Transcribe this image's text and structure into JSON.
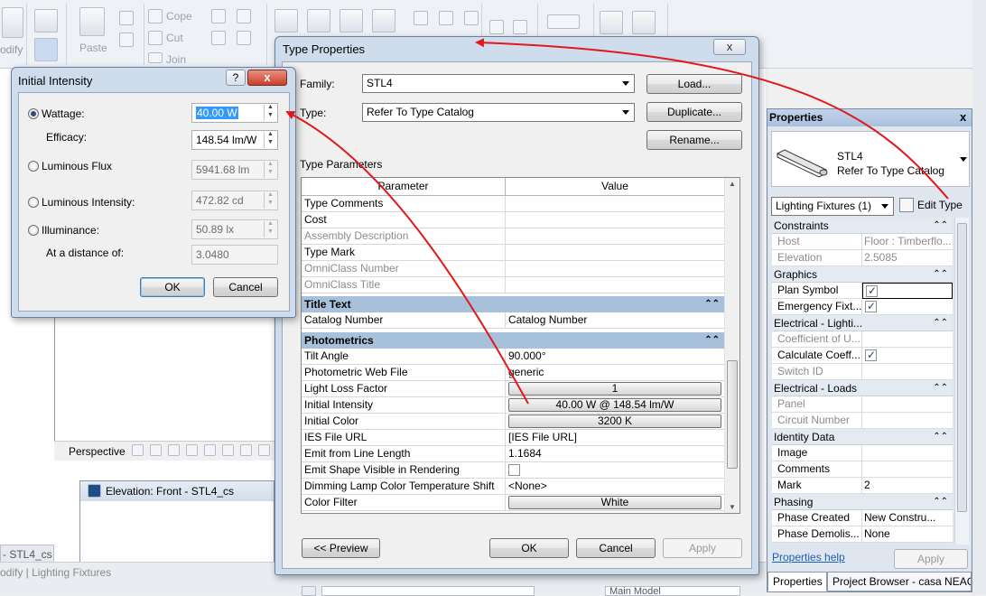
{
  "ribbon": {
    "modify_label": "odify",
    "paste_label": "Paste",
    "cope_label": "Cope",
    "cut_label": "Cut",
    "join_label": "Join"
  },
  "view": {
    "perspective_label": "Perspective",
    "elevation_title": "Elevation: Front - STL4_cs",
    "tab_stub": "- STL4_cs"
  },
  "status": {
    "text": "odify | Lighting Fixtures",
    "model": "Main Model"
  },
  "initial_intensity": {
    "title": "Initial Intensity",
    "help": "?",
    "close": "x",
    "wattage_label": "Wattage:",
    "wattage_value": "40.00 W",
    "efficacy_label": "Efficacy:",
    "efficacy_value": "148.54 lm/W",
    "flux_label": "Luminous Flux",
    "flux_value": "5941.68 lm",
    "intensity_label": "Luminous Intensity:",
    "intensity_value": "472.82 cd",
    "illuminance_label": "Illuminance:",
    "illuminance_value": "50.89 lx",
    "distance_label": "At a distance of:",
    "distance_value": "3.0480",
    "ok": "OK",
    "cancel": "Cancel"
  },
  "type_properties": {
    "title": "Type Properties",
    "close": "x",
    "family_label": "Family:",
    "family_value": "STL4",
    "type_label": "Type:",
    "type_value": "Refer To Type Catalog",
    "load": "Load...",
    "duplicate": "Duplicate...",
    "rename": "Rename...",
    "type_parameters_label": "Type Parameters",
    "col_parameter": "Parameter",
    "col_value": "Value",
    "rows_identity": [
      {
        "p": "Type Comments",
        "v": ""
      },
      {
        "p": "Cost",
        "v": ""
      },
      {
        "p": "Assembly Description",
        "v": ""
      },
      {
        "p": "Type Mark",
        "v": ""
      },
      {
        "p": "OmniClass Number",
        "v": ""
      },
      {
        "p": "OmniClass Title",
        "v": ""
      }
    ],
    "group_title_text": "Title Text",
    "row_catalog": {
      "p": "Catalog Number",
      "v": "Catalog Number"
    },
    "group_photometrics": "Photometrics",
    "rows_photometrics": [
      {
        "p": "Tilt Angle",
        "v": "90.000°"
      },
      {
        "p": "Photometric Web File",
        "v": "generic"
      },
      {
        "p": "Light Loss Factor",
        "v": "1"
      },
      {
        "p": "Initial Intensity",
        "v": "40.00 W @ 148.54 lm/W"
      },
      {
        "p": "Initial Color",
        "v": "3200 K"
      },
      {
        "p": "IES File URL",
        "v": "[IES File URL]"
      },
      {
        "p": "Emit from Line Length",
        "v": "1.1684"
      },
      {
        "p": "Emit Shape Visible in Rendering",
        "v": ""
      },
      {
        "p": "Dimming Lamp Color Temperature Shift",
        "v": "<None>"
      },
      {
        "p": "Color Filter",
        "v": "White"
      }
    ],
    "preview": "<< Preview",
    "ok": "OK",
    "cancel": "Cancel",
    "apply": "Apply"
  },
  "properties_palette": {
    "title": "Properties",
    "close": "x",
    "family_name": "STL4",
    "type_name": "Refer To Type Catalog",
    "selector": "Lighting Fixtures (1)",
    "edit_type": "Edit Type",
    "groups": {
      "constraints": "Constraints",
      "graphics": "Graphics",
      "electrical_lighting": "Electrical - Lighti...",
      "electrical_loads": "Electrical - Loads",
      "identity": "Identity Data",
      "phasing": "Phasing"
    },
    "rows": {
      "host": {
        "p": "Host",
        "v": "Floor : Timberflo..."
      },
      "elevation": {
        "p": "Elevation",
        "v": "2.5085"
      },
      "plan_symbol": {
        "p": "Plan Symbol",
        "v": ""
      },
      "emergency": {
        "p": "Emergency Fixt...",
        "v": ""
      },
      "coefficient": {
        "p": "Coefficient of U...",
        "v": ""
      },
      "calculate": {
        "p": "Calculate Coeff...",
        "v": ""
      },
      "switch_id": {
        "p": "Switch ID",
        "v": ""
      },
      "panel": {
        "p": "Panel",
        "v": ""
      },
      "circuit": {
        "p": "Circuit Number",
        "v": ""
      },
      "image": {
        "p": "Image",
        "v": ""
      },
      "comments": {
        "p": "Comments",
        "v": ""
      },
      "mark": {
        "p": "Mark",
        "v": "2"
      },
      "phase_created": {
        "p": "Phase Created",
        "v": "New Constru..."
      },
      "phase_demolished": {
        "p": "Phase Demolis...",
        "v": "None"
      }
    },
    "help_link": "Properties help",
    "apply": "Apply",
    "tab_properties": "Properties",
    "tab_browser": "Project Browser - casa NEAG..."
  },
  "colors": {
    "annotation_arrow": "#e0191b",
    "group_header": "#a8c1da",
    "selection": "#3399ff"
  }
}
